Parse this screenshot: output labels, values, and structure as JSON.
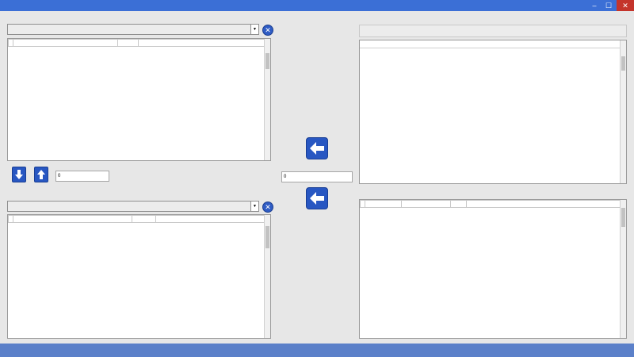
{
  "window": {
    "title": "",
    "controls": {
      "minimize": "–",
      "maximize": "☐",
      "close": "✕"
    }
  },
  "left": {
    "top_label": "",
    "top_combo_value": "",
    "top_grid": {
      "headers": [
        "",
        ""
      ],
      "rows": []
    },
    "quantity_label": "",
    "quantity_value": "0",
    "bottom_label": "",
    "bottom_combo_value": "",
    "bottom_grid": {
      "headers": [
        "",
        ""
      ],
      "rows": []
    }
  },
  "center": {
    "quantity_label": "",
    "quantity_value": "0"
  },
  "right": {
    "top_label": "",
    "find_button": "",
    "list_header": "",
    "list_items": [],
    "selected_index": null,
    "bottom_label": "",
    "bottom_grid": {
      "headers": [
        "",
        "",
        ""
      ],
      "rows": []
    }
  },
  "icons": {
    "clear": "close-circle-icon",
    "move_left": "arrow-left-icon",
    "move_up": "arrow-up-icon",
    "move_down": "arrow-down-icon"
  },
  "colors": {
    "titlebar": "#3b6fd6",
    "button": "#2857c2",
    "selection": "#2f6fd8"
  }
}
